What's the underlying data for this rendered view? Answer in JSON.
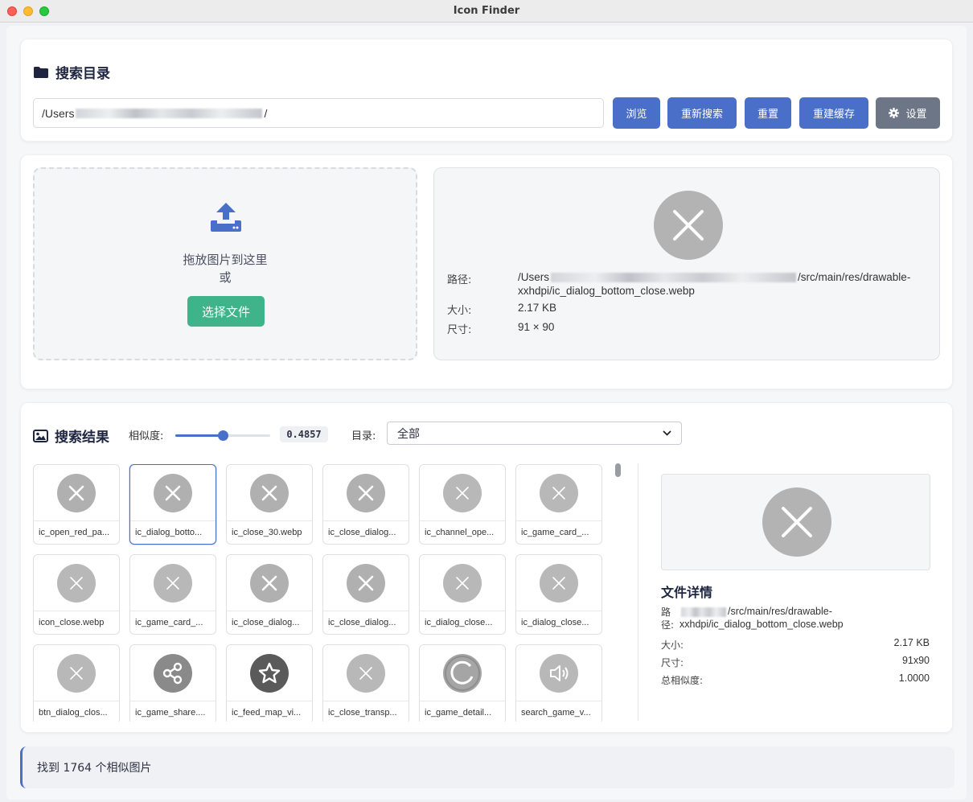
{
  "window": {
    "title": "Icon Finder"
  },
  "search_dir": {
    "title": "搜索目录",
    "path_prefix": "/Users",
    "path_suffix": "/",
    "buttons": {
      "browse": "浏览",
      "research": "重新搜索",
      "reset": "重置",
      "rebuild_cache": "重建缓存",
      "settings": "设置"
    }
  },
  "upload": {
    "drop_text": "拖放图片到这里",
    "or_text": "或",
    "choose_button": "选择文件"
  },
  "query_info": {
    "path_label": "路径:",
    "path_prefix": "/Users",
    "path_suffix": "/src/main/res/drawable-",
    "path_line2": "xxhdpi/ic_dialog_bottom_close.webp",
    "size_label": "大小:",
    "size_value": "2.17 KB",
    "dim_label": "尺寸:",
    "dim_value": "91 × 90"
  },
  "results": {
    "title": "搜索结果",
    "similarity_label": "相似度:",
    "similarity_value": "0.4857",
    "similarity_fraction": 0.5,
    "dir_label": "目录:",
    "dir_selected": "全部",
    "items": [
      {
        "name": "ic_open_red_pa...",
        "icon": "close-x",
        "shade": "#b0b0b0"
      },
      {
        "name": "ic_dialog_botto...",
        "icon": "close-x",
        "shade": "#b0b0b0",
        "selected": true
      },
      {
        "name": "ic_close_30.webp",
        "icon": "close-x",
        "shade": "#b0b0b0"
      },
      {
        "name": "ic_close_dialog...",
        "icon": "close-x",
        "shade": "#b0b0b0"
      },
      {
        "name": "ic_channel_ope...",
        "icon": "close-x-thin",
        "shade": "#b8b8b8"
      },
      {
        "name": "ic_game_card_...",
        "icon": "close-x-thin",
        "shade": "#b8b8b8"
      },
      {
        "name": "icon_close.webp",
        "icon": "close-x-thin",
        "shade": "#b8b8b8"
      },
      {
        "name": "ic_game_card_...",
        "icon": "close-x-thin",
        "shade": "#b8b8b8"
      },
      {
        "name": "ic_close_dialog...",
        "icon": "close-x",
        "shade": "#b0b0b0"
      },
      {
        "name": "ic_close_dialog...",
        "icon": "close-x",
        "shade": "#b0b0b0"
      },
      {
        "name": "ic_dialog_close...",
        "icon": "close-x-thin",
        "shade": "#b8b8b8"
      },
      {
        "name": "ic_dialog_close...",
        "icon": "close-x-thin",
        "shade": "#b8b8b8"
      },
      {
        "name": "btn_dialog_clos...",
        "icon": "close-x-thin",
        "shade": "#b8b8b8"
      },
      {
        "name": "ic_game_share....",
        "icon": "share",
        "shade": "#8a8a8a"
      },
      {
        "name": "ic_feed_map_vi...",
        "icon": "star",
        "shade": "#5a5a5a"
      },
      {
        "name": "ic_close_transp...",
        "icon": "close-x-thin",
        "shade": "#b8b8b8"
      },
      {
        "name": "ic_game_detail...",
        "icon": "refresh",
        "shade": "#a5a5a5"
      },
      {
        "name": "search_game_v...",
        "icon": "speaker",
        "shade": "#b8b8b8"
      }
    ]
  },
  "file_detail": {
    "title": "文件详情",
    "path_label_1": "路",
    "path_label_2": "径:",
    "path_suffix": "/src/main/res/drawable-",
    "path_line2": "xxhdpi/ic_dialog_bottom_close.webp",
    "size_label": "大小:",
    "size_value": "2.17 KB",
    "dim_label": "尺寸:",
    "dim_value": "91x90",
    "sim_label": "总相似度:",
    "sim_value": "1.0000"
  },
  "status": {
    "text": "找到 1764 个相似图片"
  },
  "colors": {
    "accent": "#4a6fc9",
    "green": "#3fb389",
    "gray_button": "#6c7686"
  }
}
